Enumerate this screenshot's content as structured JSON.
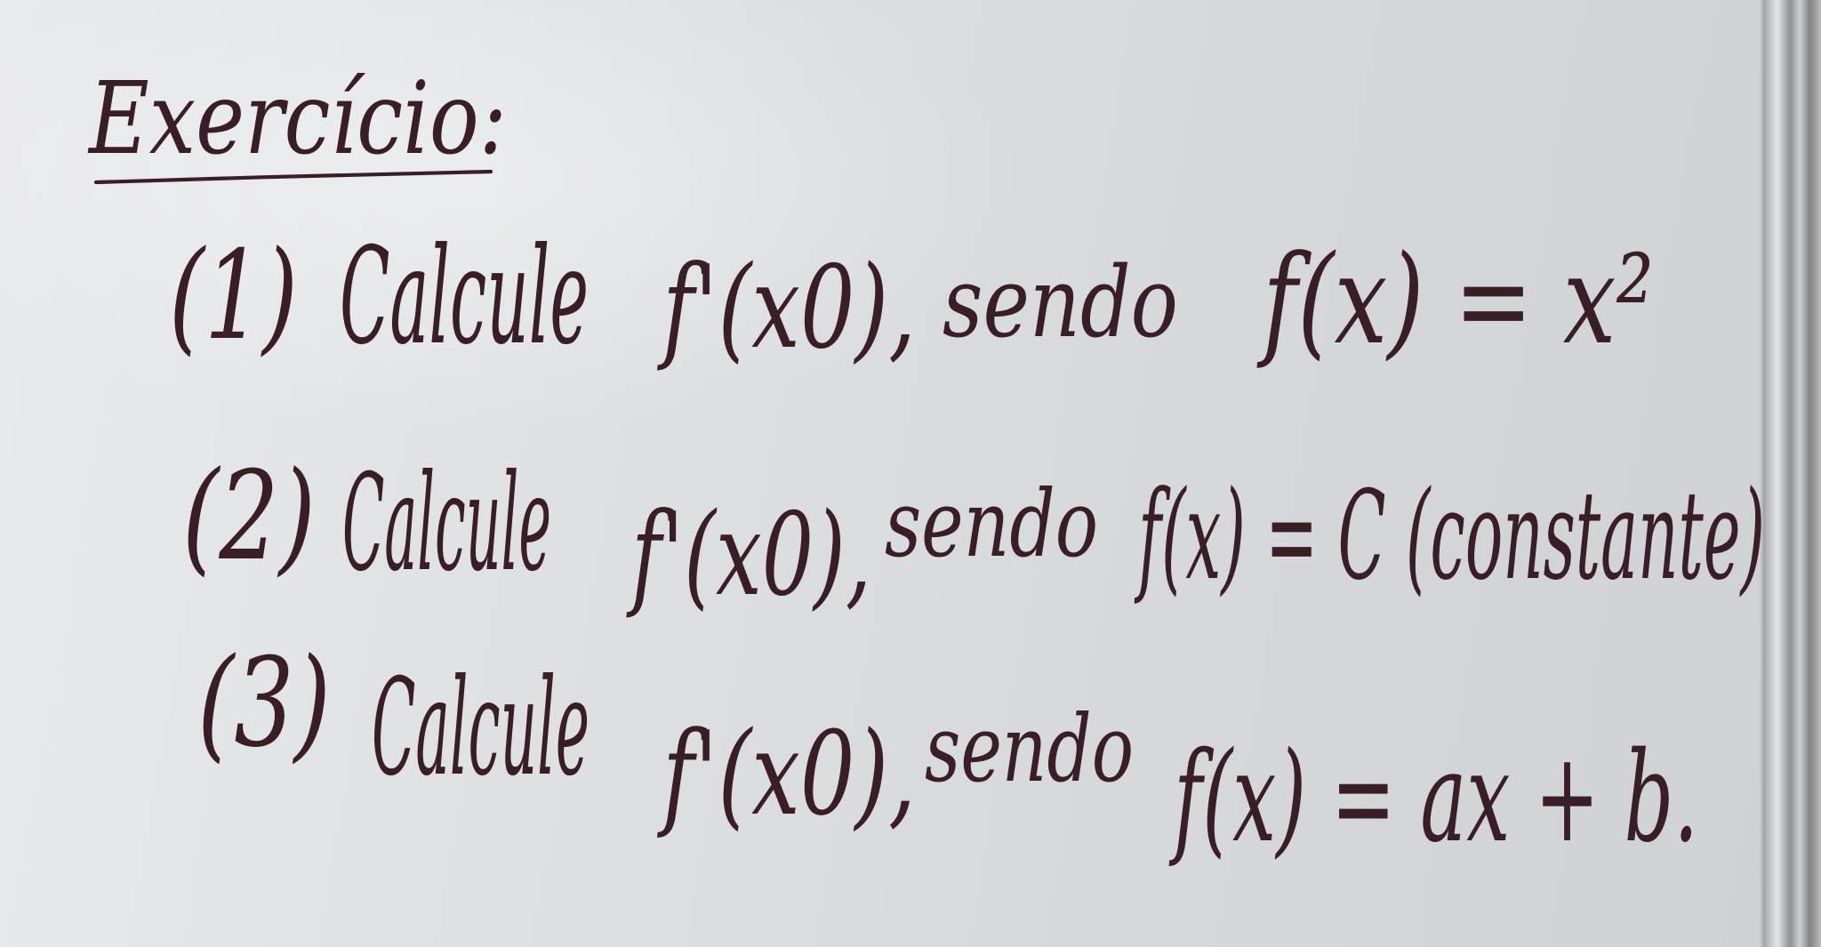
{
  "board": {
    "title": "Exercício:",
    "items": [
      {
        "number": "(1)",
        "verb": "Calcule",
        "derivative": "f'(x0),",
        "connector": "sendo",
        "function": "f(x) = x²"
      },
      {
        "number": "(2)",
        "verb": "Calcule",
        "derivative": "f'(x0),",
        "connector": "sendo",
        "function": "f(x) = C (constante)"
      },
      {
        "number": "(3)",
        "verb": "Calcule",
        "derivative": "f'(x0),",
        "connector": "sendo",
        "function": "f(x) = ax + b."
      }
    ]
  },
  "colors": {
    "ink": "#3a1e25",
    "board": "#e1e3e5",
    "frame": "#a9abad"
  }
}
